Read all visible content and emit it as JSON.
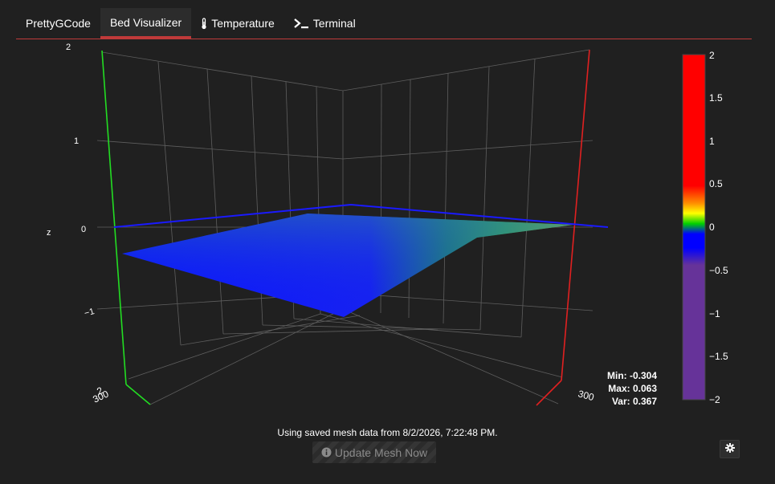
{
  "tabs": [
    {
      "label": "PrettyGCode",
      "icon": ""
    },
    {
      "label": "Bed Visualizer",
      "icon": ""
    },
    {
      "label": "Temperature",
      "icon": "thermometer-icon"
    },
    {
      "label": "Terminal",
      "icon": "terminal-icon"
    }
  ],
  "active_tab": 1,
  "plot": {
    "z_axis_label": "z",
    "z_ticks": [
      "1",
      "0",
      "−1"
    ],
    "x_corner_labels": {
      "left_300": "300",
      "left_2": "2",
      "right_300": "300"
    },
    "top_tick": "2",
    "colorbar_ticks": [
      "2",
      "1.5",
      "1",
      "0.5",
      "0",
      "−0.5",
      "−1",
      "−1.5",
      "−2"
    ],
    "colors": {
      "x_axis": "#e02020",
      "y_axis": "#22dd22",
      "plane": "#1a1aff",
      "surface_low": "#0a14ff",
      "surface_high": "#7fd020"
    }
  },
  "chart_data": {
    "type": "surface",
    "zlim": [
      -2,
      2
    ],
    "mesh_summary": {
      "min": -0.304,
      "max": 0.063,
      "var": 0.367
    },
    "colorscale_range": [
      -2,
      2
    ]
  },
  "stats": {
    "min_text": "Min: -0.304",
    "max_text": "Max: 0.063",
    "var_text": "Var: 0.367"
  },
  "status_message": "Using saved mesh data from 8/2/2026, 7:22:48 PM.",
  "update_button": {
    "label": "Update Mesh Now",
    "icon": "info-circle-icon",
    "disabled": true
  },
  "settings_button": {
    "icon": "gear-icon"
  }
}
